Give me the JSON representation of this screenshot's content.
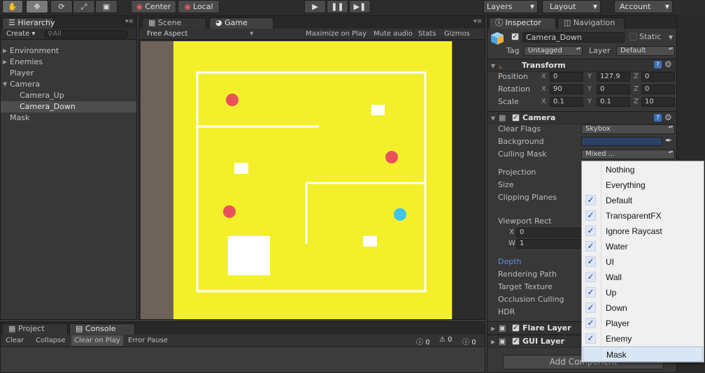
{
  "toolbar": {
    "pivot": "Center",
    "space": "Local",
    "layers": "Layers",
    "layout": "Layout",
    "account": "Account"
  },
  "hierarchy": {
    "tab": "Hierarchy",
    "create": "Create",
    "search_placeholder": "All",
    "items": [
      {
        "label": "Environment",
        "has_children": true,
        "expanded": false
      },
      {
        "label": "Enemies",
        "has_children": true,
        "expanded": false
      },
      {
        "label": "Player",
        "has_children": false,
        "expanded": false
      },
      {
        "label": "Camera",
        "has_children": true,
        "expanded": true
      },
      {
        "label": "Camera_Up",
        "has_children": false,
        "expanded": false
      },
      {
        "label": "Camera_Down",
        "has_children": false,
        "expanded": false,
        "selected": true
      },
      {
        "label": "Mask",
        "has_children": false,
        "expanded": false
      }
    ]
  },
  "game_view": {
    "tabs": [
      "Scene",
      "Game"
    ],
    "aspect": "Free Aspect",
    "buttons": [
      "Maximize on Play",
      "Mute audio",
      "Stats",
      "Gizmos"
    ],
    "colors": {
      "background": "#6e635b",
      "floor": "#f3f02b",
      "wall": "#ffffff",
      "enemy": "#e9525b",
      "player": "#3cc6ea"
    }
  },
  "bottom": {
    "tabs": [
      "Project",
      "Console"
    ],
    "buttons": [
      "Clear",
      "Collapse",
      "Clear on Play",
      "Error Pause"
    ],
    "counts": {
      "errors": "0",
      "warnings": "0",
      "messages": "0"
    }
  },
  "inspector": {
    "tabs": [
      "Inspector",
      "Navigation"
    ],
    "object_name": "Camera_Down",
    "static_label": "Static",
    "tag_label": "Tag",
    "tag": "Untagged",
    "layer_label": "Layer",
    "layer": "Default",
    "transform": {
      "title": "Transform",
      "rows": [
        {
          "label": "Position",
          "x": "0",
          "y": "127.9",
          "z": "0"
        },
        {
          "label": "Rotation",
          "x": "90",
          "y": "0",
          "z": "0"
        },
        {
          "label": "Scale",
          "x": "0.1",
          "y": "0.1",
          "z": "10"
        }
      ]
    },
    "camera": {
      "title": "Camera",
      "clear_flags_label": "Clear Flags",
      "clear_flags": "Skybox",
      "background_label": "Background",
      "background_color": "#2b4167",
      "culling_mask_label": "Culling Mask",
      "culling_mask": "Mixed ...",
      "projection_label": "Projection",
      "size_label": "Size",
      "clipping_label": "Clipping Planes",
      "viewport_label": "Viewport Rect",
      "vp_x_label": "X",
      "vp_x": "0",
      "vp_w_label": "W",
      "vp_w": "1",
      "depth_label": "Depth",
      "rendering_path_label": "Rendering Path",
      "target_texture_label": "Target Texture",
      "occlusion_label": "Occlusion Culling",
      "hdr_label": "HDR"
    },
    "flare_layer": "Flare Layer",
    "gui_layer": "GUI Layer",
    "add_component": "Add Component"
  },
  "culling_menu": {
    "items": [
      {
        "label": "Nothing",
        "checked": false
      },
      {
        "label": "Everything",
        "checked": false
      },
      {
        "label": "Default",
        "checked": true
      },
      {
        "label": "TransparentFX",
        "checked": true
      },
      {
        "label": "Ignore Raycast",
        "checked": true
      },
      {
        "label": "Water",
        "checked": true
      },
      {
        "label": "UI",
        "checked": true
      },
      {
        "label": "Wall",
        "checked": true
      },
      {
        "label": "Up",
        "checked": true
      },
      {
        "label": "Down",
        "checked": true
      },
      {
        "label": "Player",
        "checked": true
      },
      {
        "label": "Enemy",
        "checked": true
      },
      {
        "label": "Mask",
        "checked": false,
        "highlighted": true
      }
    ]
  }
}
